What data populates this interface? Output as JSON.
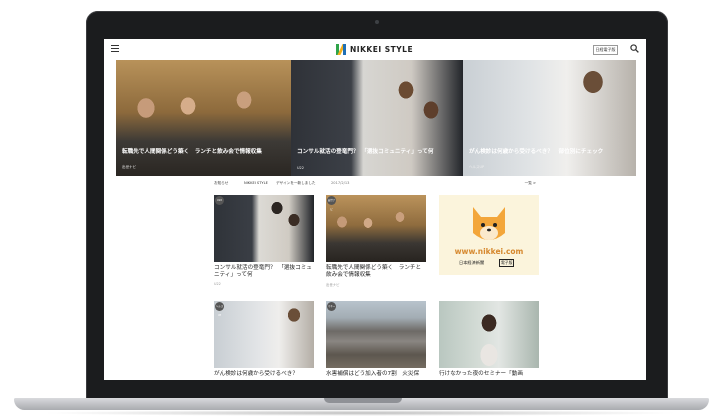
{
  "header": {
    "logo_text": "NIKKEI STYLE",
    "edition_button": "日経電子版",
    "colors": {
      "logo_green": "#2fa44a",
      "logo_blue": "#1f6fb5",
      "logo_yellow": "#f2b01e"
    }
  },
  "hero": [
    {
      "caption": "転職先で人間関係どう築く　ランチと飲み会で情報収集",
      "tag": "出世ナビ"
    },
    {
      "caption": "コンサル就活の登竜門？　「選抜コミュニティ」って何",
      "tag": "U22"
    },
    {
      "caption": "がん検診は何歳から受けるべき？　部位別にチェック",
      "tag": "ヘルスUP"
    }
  ],
  "notice": {
    "label": "お知らせ",
    "site": "NIKKEI STYLE",
    "text": "デザインを一新しました",
    "date": "2017/2/13",
    "more": "一覧 >"
  },
  "cards": [
    {
      "badge": "U22",
      "title": "コンサル就活の登竜門？　「選抜コミュニティ」って何",
      "meta": "U22"
    },
    {
      "badge": "出世ナビ",
      "title": "転職先で人間関係どう築く　ランチと飲み会で情報収集",
      "meta": "出世ナビ"
    },
    {
      "badge": "ヘルスUP",
      "title": "がん検診は何歳から受けるべき？",
      "meta": ""
    },
    {
      "badge": "マネー",
      "title": "水害補償はどう加入者の7割　火災保",
      "meta": ""
    },
    {
      "badge": "",
      "title": "行けなかった夜のセミナー「動画",
      "meta": ""
    }
  ],
  "ad": {
    "url": "www.nikkei.com",
    "brand": "日本経済新聞",
    "tag": "電子版"
  }
}
